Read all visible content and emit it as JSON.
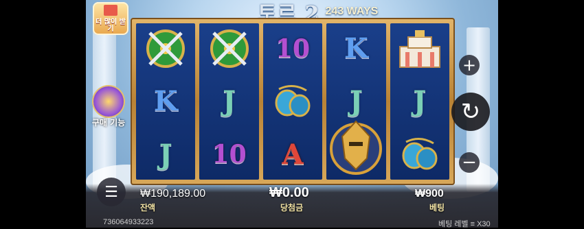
{
  "game": {
    "logo": "토르 2",
    "ways": "243 WAYS"
  },
  "side": {
    "more_label": "더 많이 받기",
    "buy_label": "구매 기능"
  },
  "reels": [
    [
      "shields-swords",
      "K",
      "J"
    ],
    [
      "shields-swords",
      "J",
      "10"
    ],
    [
      "10",
      "cups",
      "A"
    ],
    [
      "K",
      "J",
      "thor"
    ],
    [
      "temple",
      "J",
      "cups"
    ]
  ],
  "bottom": {
    "balance_value": "₩190,189.00",
    "balance_label": "잔액",
    "win_value": "₩0.00",
    "win_label": "당첨금",
    "bet_value": "₩900",
    "bet_label": "베팅",
    "round_id": "736064933223",
    "bet_level": "베팅 레벨 ≡ X30"
  },
  "colors": {
    "frame_gold": "#d4a14f",
    "reel_blue": "#153a7e",
    "sky": "#b9d6ef"
  }
}
